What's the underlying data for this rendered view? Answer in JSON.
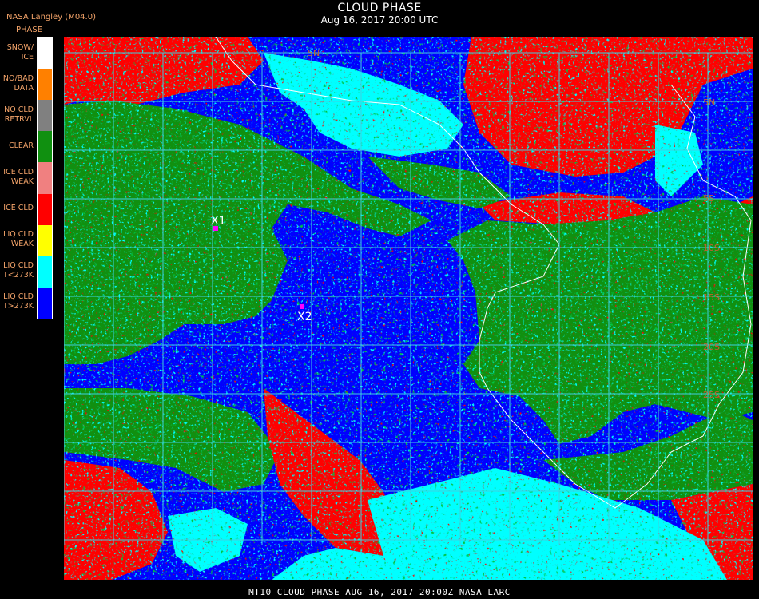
{
  "header": {
    "title": "CLOUD PHASE",
    "subtitle": "Aug 16, 2017 20:00 UTC",
    "agency": "NASA Langley (M04.0)"
  },
  "legend": {
    "title": "PHASE",
    "items": [
      {
        "label": "SNOW/\nICE",
        "color": "#ffffff"
      },
      {
        "label": "NO/BAD\nDATA",
        "color": "#ff8000"
      },
      {
        "label": "NO CLD\nRETRVL",
        "color": "#808080"
      },
      {
        "label": "CLEAR",
        "color": "#109010"
      },
      {
        "label": "ICE CLD\nWEAK",
        "color": "#f08080"
      },
      {
        "label": "ICE CLD",
        "color": "#ff0000"
      },
      {
        "label": "LIQ CLD\nWEAK",
        "color": "#ffff00"
      },
      {
        "label": "LIQ CLD\nT<273K",
        "color": "#00ffff"
      },
      {
        "label": "LIQ CLD\nT>273K",
        "color": "#0000ff"
      }
    ]
  },
  "map": {
    "markers": [
      {
        "label": "X1",
        "color": "#ff00ff"
      },
      {
        "label": "X2",
        "color": "#ff00ff"
      }
    ],
    "lat_labels": [
      "5N",
      "5N",
      "5S",
      "10S",
      "15S",
      "20S",
      "25S"
    ],
    "grid_color": "#3fd0e0",
    "label_color": "#c06030"
  },
  "footer": {
    "text": "MT10  CLOUD PHASE   AUG 16, 2017 20:00Z   NASA LARC"
  }
}
